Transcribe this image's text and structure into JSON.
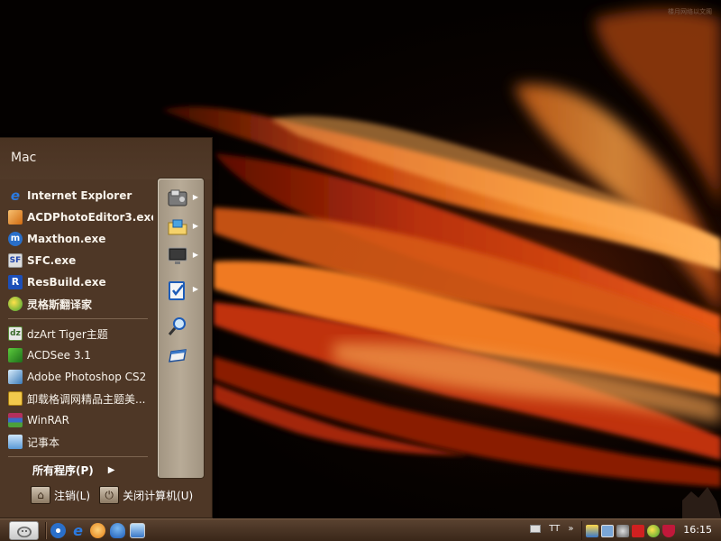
{
  "watermark": "楼月网络以文阁",
  "start_menu": {
    "user_name": "Mac",
    "pinned": [
      {
        "label": "Internet Explorer",
        "icon": "internet-explorer-icon"
      },
      {
        "label": "ACDPhotoEditor3.exe",
        "icon": "acd-photo-editor-icon"
      },
      {
        "label": "Maxthon.exe",
        "icon": "maxthon-icon"
      },
      {
        "label": "SFC.exe",
        "icon": "sfc-icon"
      },
      {
        "label": "ResBuild.exe",
        "icon": "resbuild-icon"
      },
      {
        "label": "灵格斯翻译家",
        "icon": "lingoes-icon"
      }
    ],
    "recent": [
      {
        "label": "dzArt Tiger主题",
        "icon": "dzart-icon"
      },
      {
        "label": "ACDSee 3.1",
        "icon": "acdsee-icon"
      },
      {
        "label": "Adobe Photoshop CS2",
        "icon": "photoshop-icon"
      },
      {
        "label": "卸载格调网精品主题美...",
        "icon": "uninstall-theme-icon"
      },
      {
        "label": "WinRAR",
        "icon": "winrar-icon"
      },
      {
        "label": "记事本",
        "icon": "notepad-icon"
      }
    ],
    "all_programs": "所有程序(P)",
    "logoff": "注销(L)",
    "shutdown": "关闭计算机(U)",
    "side_panel": [
      {
        "icon": "my-documents-icon",
        "has_submenu": true
      },
      {
        "icon": "my-computer-folder-icon",
        "has_submenu": true
      },
      {
        "icon": "control-panel-monitor-icon",
        "has_submenu": true
      },
      {
        "icon": "tasks-checklist-icon",
        "has_submenu": true
      },
      {
        "icon": "search-icon",
        "has_submenu": false
      },
      {
        "icon": "run-icon",
        "has_submenu": false
      }
    ]
  },
  "taskbar": {
    "tray_text": "TT",
    "tray_chevron": "»",
    "clock": "16:15"
  },
  "colors": {
    "menu_bg": "#4e3726",
    "panel_bg": "#b1a48f",
    "taskbar_bg": "#4a3424",
    "accent_flower": "#f07a18"
  }
}
